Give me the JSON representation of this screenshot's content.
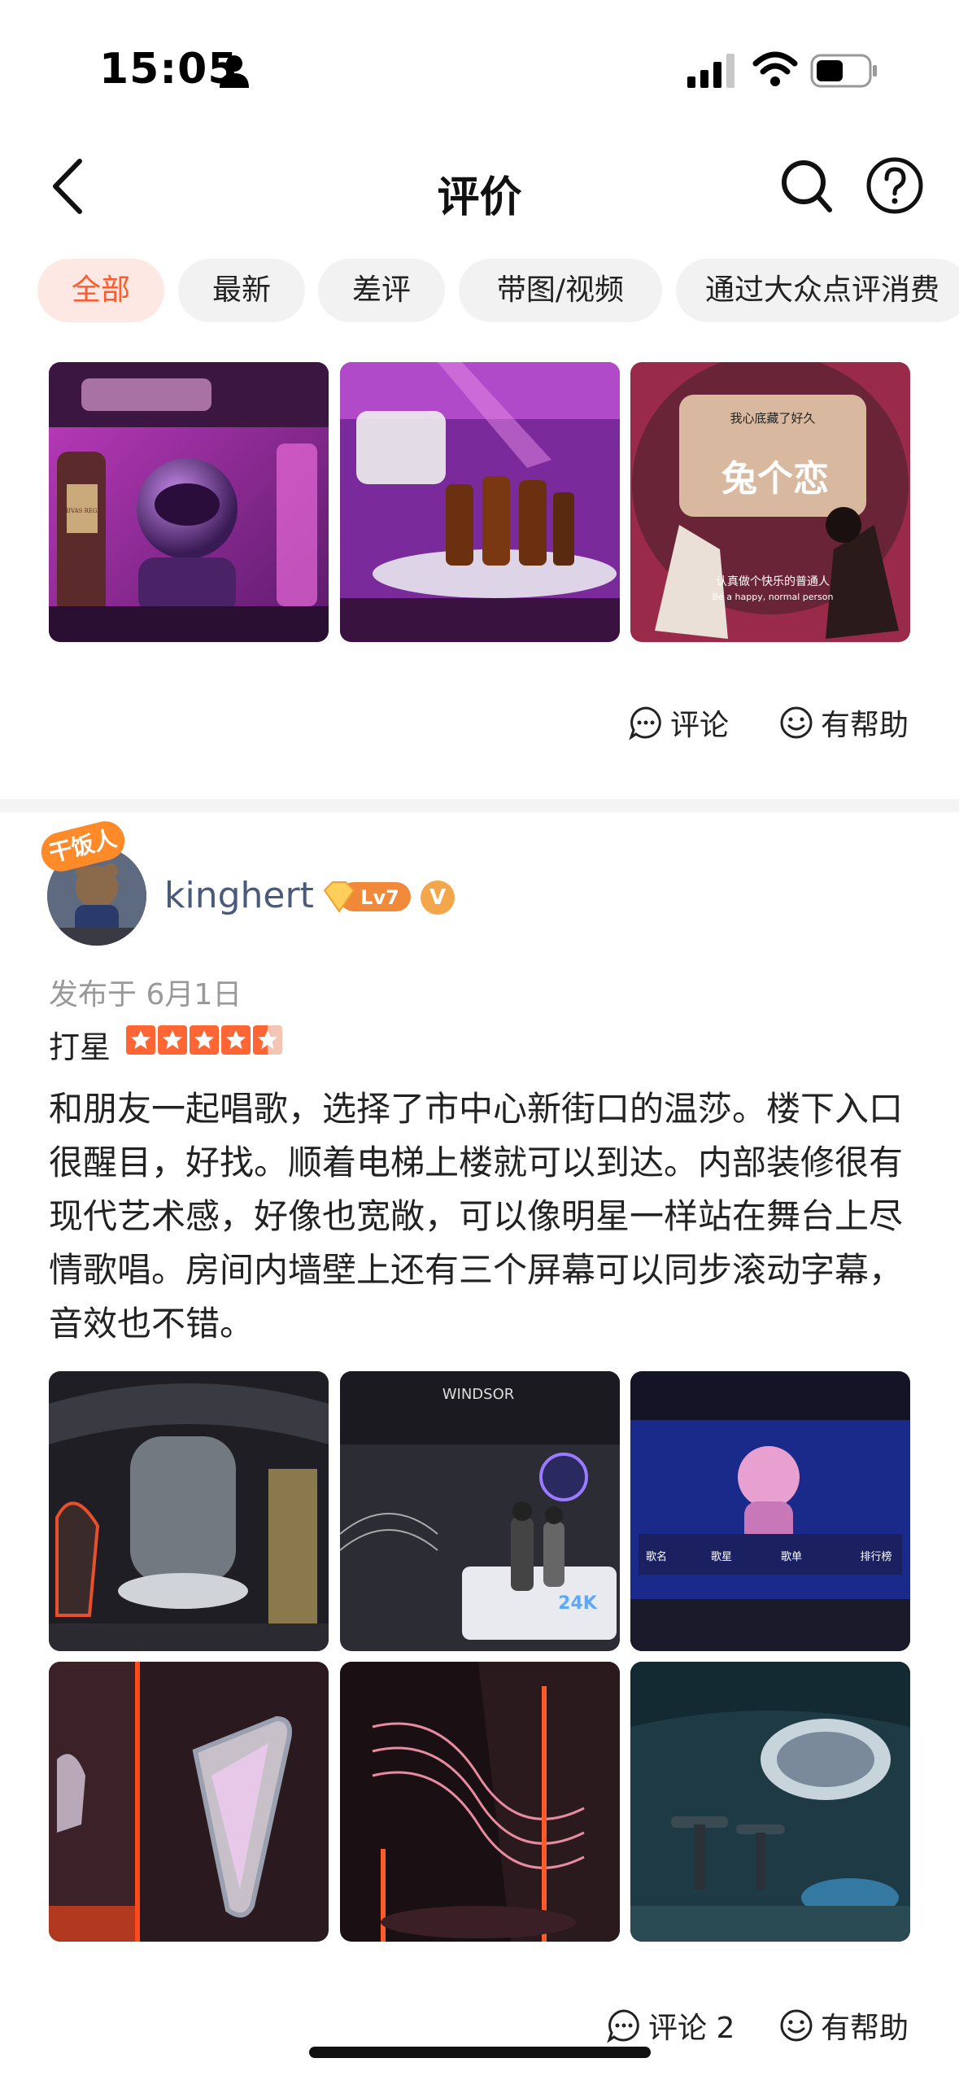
{
  "status_bar": {
    "time": "15:05"
  },
  "nav": {
    "title": "评价"
  },
  "filters": [
    "全部",
    "最新",
    "差评",
    "带图/视频",
    "通过大众点评消费"
  ],
  "first_review": {
    "actions": {
      "comment_label": "评论",
      "helpful_label": "有帮助"
    },
    "image_texts": {
      "bottle_label": "CHIVAS REGAL",
      "song_lyric_top": "我心底藏了好久",
      "song_title": "兔个恋",
      "subtitle_cn": "认真做个快乐的普通人",
      "subtitle_en": "Be a happy, normal person"
    }
  },
  "review": {
    "badge": "干饭人",
    "username": "kinghert",
    "level": "Lv7",
    "verified": "V",
    "date": "发布于 6月1日",
    "rating_label": "打星",
    "rating": 4.5,
    "text": "和朋友一起唱歌，选择了市中心新街口的温莎。楼下入口很醒目，好找。顺着电梯上楼就可以到达。内部装修很有现代艺术感，好像也宽敞，可以像明星一样站在舞台上尽情歌唱。房间内墙壁上还有三个屏幕可以同步滚动字幕，音效也不错。",
    "image_texts": {
      "brand": "WINDSOR",
      "logo": "24K",
      "menu": [
        "歌名",
        "歌星",
        "歌单",
        "排行榜"
      ]
    },
    "actions": {
      "comment_label": "评论 2",
      "helpful_label": "有帮助"
    }
  },
  "colors": {
    "accent": "#ff5a2b",
    "chip_bg": "#f2f2f2",
    "username": "#4a5a7a",
    "star": "#ff6633"
  }
}
